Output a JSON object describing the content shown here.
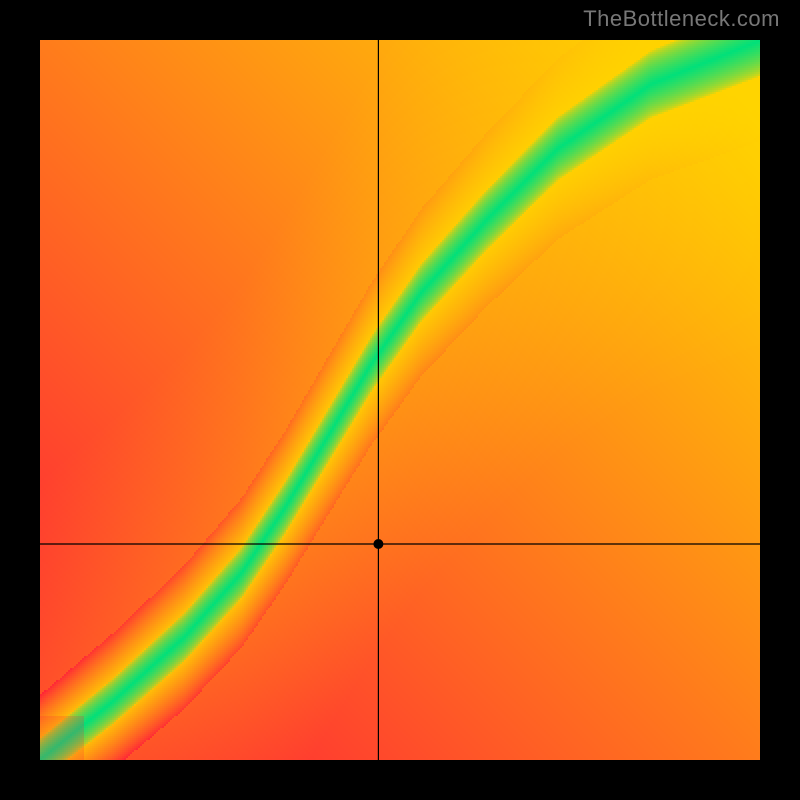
{
  "watermark": "TheBottleneck.com",
  "chart_data": {
    "type": "heatmap",
    "title": "",
    "xlabel": "",
    "ylabel": "",
    "xlim": [
      0,
      100
    ],
    "ylim": [
      0,
      100
    ],
    "grid": false,
    "legend": false,
    "crosshair": {
      "x": 47,
      "y": 30
    },
    "marker": {
      "x": 47,
      "y": 30
    },
    "optimal_curve": {
      "description": "green ridge of ideal pairing; values are (x, y) in percent of axis range",
      "points": [
        [
          0,
          0
        ],
        [
          10,
          8
        ],
        [
          20,
          17
        ],
        [
          28,
          26
        ],
        [
          34,
          35
        ],
        [
          40,
          45
        ],
        [
          46,
          55
        ],
        [
          53,
          65
        ],
        [
          62,
          75
        ],
        [
          72,
          85
        ],
        [
          85,
          94
        ],
        [
          100,
          100
        ]
      ]
    },
    "color_scale": {
      "bad": "#ff1a3a",
      "warn": "#ffd400",
      "ok": "#00e07a"
    }
  }
}
